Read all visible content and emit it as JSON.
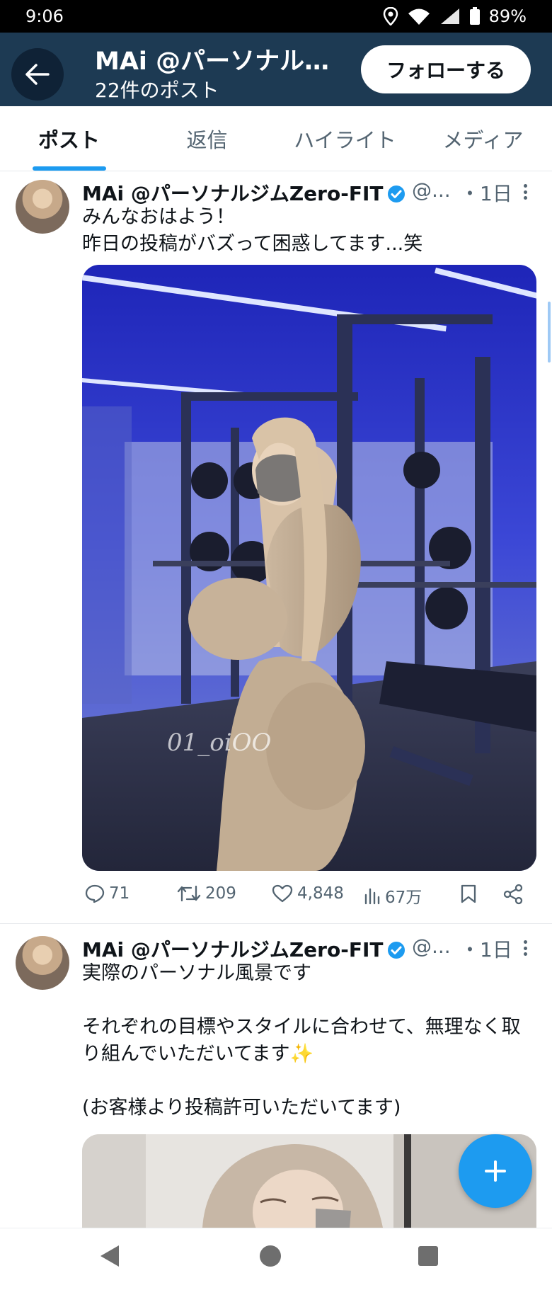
{
  "status_bar": {
    "time": "9:06",
    "battery": "89%"
  },
  "header": {
    "title": "MAi @パーソナル…",
    "subtitle": "22件のポスト",
    "follow_label": "フォローする"
  },
  "tabs": [
    {
      "label": "ポスト",
      "active": true
    },
    {
      "label": "返信",
      "active": false
    },
    {
      "label": "ハイライト",
      "active": false
    },
    {
      "label": "メディア",
      "active": false
    }
  ],
  "tweets": [
    {
      "name": "MAi @パーソナルジムZero-FIT",
      "handle": "@...",
      "time": "・1日",
      "text": "みんなおはよう！\n昨日の投稿がバズって困惑してます...笑",
      "media_watermark": "01_oiOO",
      "replies": "71",
      "retweets": "209",
      "likes": "4,848",
      "views": "67万"
    },
    {
      "name": "MAi @パーソナルジムZero-FIT",
      "handle": "@...",
      "time": "・1日",
      "text": "実際のパーソナル風景です\n\nそれぞれの目標やスタイルに合わせて、無理なく取り組んでいただいてます✨\n\n(お客様より投稿許可いただいてます)"
    }
  ],
  "colors": {
    "header_bg": "#1d3a53",
    "accent": "#1d9bf0",
    "verified": "#1d9bf0"
  },
  "icons": {
    "back": "arrow-left-icon",
    "fab": "plus-icon",
    "reply": "speech-bubble-icon",
    "retweet": "retweet-icon",
    "like": "heart-icon",
    "views": "bar-chart-icon",
    "bookmark": "bookmark-icon",
    "share": "share-icon"
  }
}
